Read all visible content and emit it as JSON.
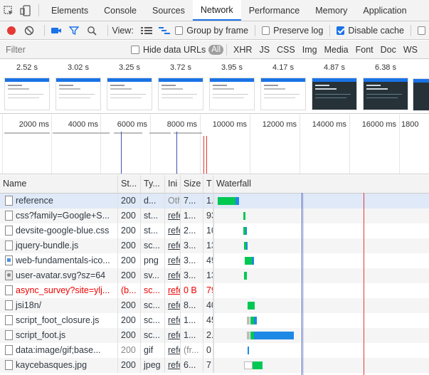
{
  "tabs": [
    "Elements",
    "Console",
    "Sources",
    "Network",
    "Performance",
    "Memory",
    "Application"
  ],
  "active_tab": "Network",
  "toolbar": {
    "view_label": "View:",
    "group_by_frame": "Group by frame",
    "preserve_log": "Preserve log",
    "disable_cache": "Disable cache"
  },
  "filter": {
    "placeholder": "Filter",
    "hide_data_urls": "Hide data URLs",
    "types": [
      "All",
      "XHR",
      "JS",
      "CSS",
      "Img",
      "Media",
      "Font",
      "Doc",
      "WS"
    ]
  },
  "filmstrip": {
    "times": [
      "2.52 s",
      "3.02 s",
      "3.25 s",
      "3.72 s",
      "3.95 s",
      "4.17 s",
      "4.87 s",
      "6.38 s"
    ]
  },
  "overview": {
    "ticks": [
      "2000 ms",
      "4000 ms",
      "6000 ms",
      "8000 ms",
      "10000 ms",
      "12000 ms",
      "14000 ms",
      "16000 ms",
      "1800"
    ]
  },
  "columns": {
    "name": "Name",
    "status": "St...",
    "type": "Ty...",
    "initiator": "Ini",
    "size": "Size",
    "time": "T",
    "waterfall": "Waterfall"
  },
  "rows": [
    {
      "name": "reference",
      "status": "200",
      "type": "d...",
      "initiator": "Oth",
      "size": "7...",
      "time": "1."
    },
    {
      "name": "css?family=Google+S...",
      "status": "200",
      "type": "st...",
      "initiator": "refe",
      "size": "1...",
      "time": "93"
    },
    {
      "name": "devsite-google-blue.css",
      "status": "200",
      "type": "st...",
      "initiator": "refe",
      "size": "2...",
      "time": "10"
    },
    {
      "name": "jquery-bundle.js",
      "status": "200",
      "type": "sc...",
      "initiator": "refe",
      "size": "3...",
      "time": "13"
    },
    {
      "name": "web-fundamentals-ico...",
      "status": "200",
      "type": "png",
      "initiator": "refe",
      "size": "3...",
      "time": "49"
    },
    {
      "name": "user-avatar.svg?sz=64",
      "status": "200",
      "type": "sv...",
      "initiator": "refe",
      "size": "3...",
      "time": "13"
    },
    {
      "name": "async_survey?site=ylj...",
      "status": "(b...",
      "type": "sc...",
      "initiator": "refe",
      "size": "0 B",
      "time": "79"
    },
    {
      "name": "jsi18n/",
      "status": "200",
      "type": "sc...",
      "initiator": "refe",
      "size": "8...",
      "time": "40"
    },
    {
      "name": "script_foot_closure.js",
      "status": "200",
      "type": "sc...",
      "initiator": "refe",
      "size": "1...",
      "time": "45"
    },
    {
      "name": "script_foot.js",
      "status": "200",
      "type": "sc...",
      "initiator": "refe",
      "size": "1...",
      "time": "2."
    },
    {
      "name": "data:image/gif;base...",
      "status": "200",
      "type": "gif",
      "initiator": "refe",
      "size": "(fr...",
      "time": "0"
    },
    {
      "name": "kaycebasques.jpg",
      "status": "200",
      "type": "jpeg",
      "initiator": "refe",
      "size": "6...",
      "time": "7"
    }
  ],
  "colors": {
    "record": "#e53935",
    "accent": "#1a73e8",
    "waiting": "#00c853",
    "download": "#1e88e5",
    "dom_content_loaded": "#3f51b5",
    "load": "#e53935",
    "error_text": "#e00000"
  }
}
